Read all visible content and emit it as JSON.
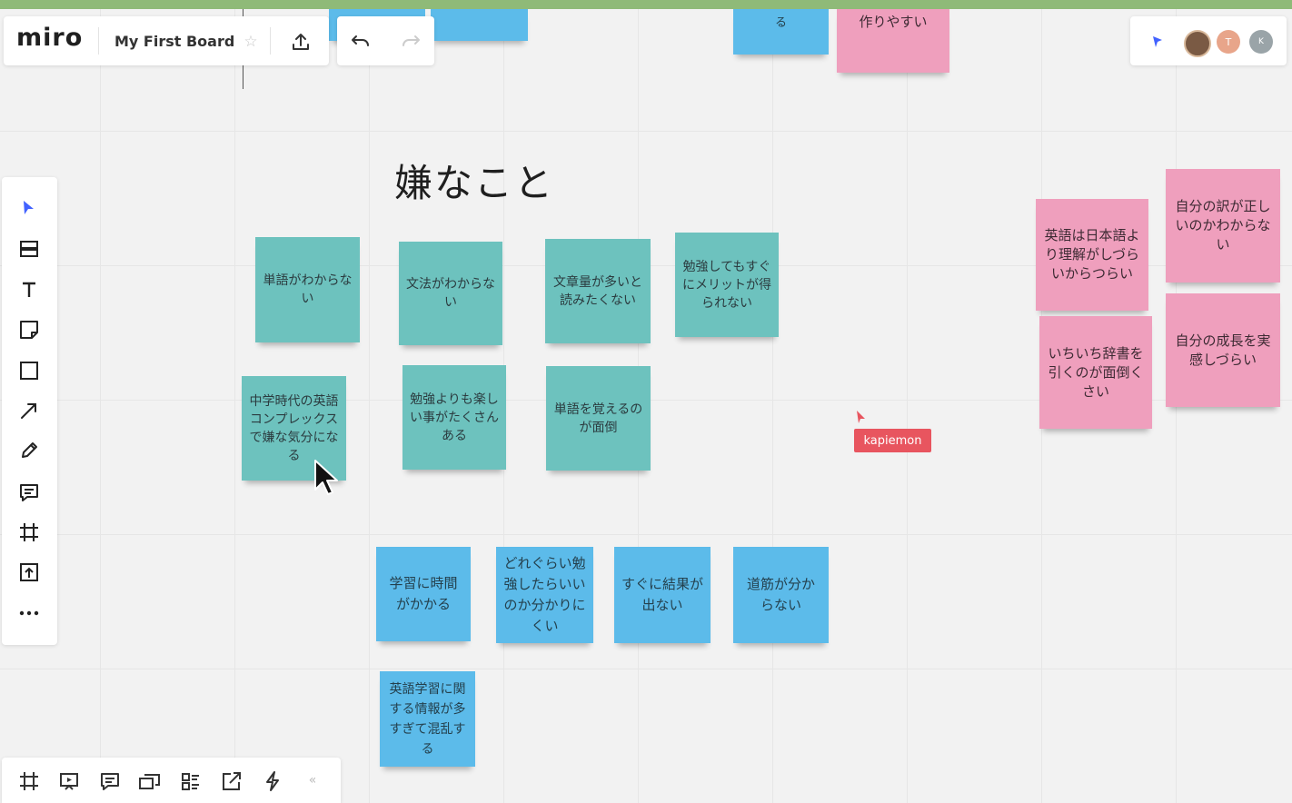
{
  "app": {
    "logo": "miro",
    "board_title": "My First Board"
  },
  "collaborator": {
    "cursor_label": "kapiemon",
    "cursor_color": "#e8555f"
  },
  "avatars": [
    "",
    "T",
    "K"
  ],
  "heading": "嫌なこと",
  "top_notes": {
    "partial_blue_1": "",
    "partial_blue_2": "る",
    "partial_pink": "作りやすい"
  },
  "teal_notes": [
    "単語がわからない",
    "文法がわからない",
    "文章量が多いと読みたくない",
    "勉強してもすぐにメリットが得られない",
    "中学時代の英語コンプレックスで嫌な気分になる",
    "勉強よりも楽しい事がたくさんある",
    "単語を覚えるのが面倒"
  ],
  "blue_notes": [
    "学習に時間がかかる",
    "どれぐらい勉強したらいいのか分かりにくい",
    "すぐに結果が出ない",
    "道筋が分からない",
    "英語学習に関する情報が多すぎて混乱する"
  ],
  "pink_notes": [
    "英語は日本語より理解がしづらいからつらい",
    "自分の訳が正しいのかわからない",
    "いちいち辞書を引くのが面倒くさい",
    "自分の成長を実感しづらい"
  ],
  "colors": {
    "teal": "#6dc2be",
    "blue": "#5cbbea",
    "pink": "#ef9fbd",
    "accent": "#4262ff",
    "top_strip": "#8fba78"
  },
  "left_toolbar": [
    "select-icon",
    "templates-icon",
    "text-icon",
    "sticky-note-icon",
    "shape-icon",
    "arrow-icon",
    "pen-icon",
    "comment-icon",
    "frame-icon",
    "upload-icon",
    "more-icon"
  ],
  "bottom_toolbar": [
    "frames-icon",
    "presentation-icon",
    "comments-icon",
    "video-chat-icon",
    "card-icon",
    "share-screen-icon",
    "activity-icon",
    "collapse-icon"
  ],
  "bottom_collapse_label": "«"
}
